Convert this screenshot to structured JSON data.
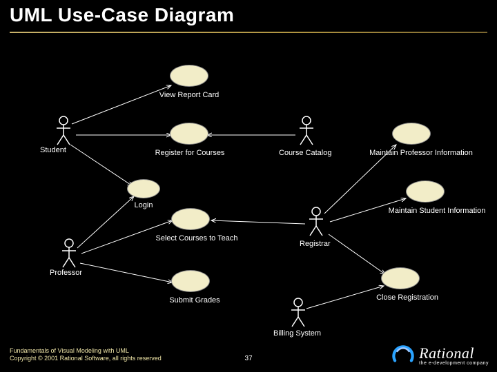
{
  "title": "UML Use-Case Diagram",
  "actors": {
    "student": "Student",
    "professor": "Professor",
    "courseCatalog": "Course Catalog",
    "registrar": "Registrar",
    "billingSystem": "Billing System"
  },
  "usecases": {
    "viewReportCard": "View Report Card",
    "registerForCourses": "Register for Courses",
    "login": "Login",
    "selectCoursesToTeach": "Select Courses to Teach",
    "submitGrades": "Submit Grades",
    "maintainProfessorInfo": "Maintain Professor Information",
    "maintainStudentInfo": "Maintain Student Information",
    "closeRegistration": "Close Registration"
  },
  "footer": {
    "line1": "Fundamentals of Visual Modeling with UML",
    "line2": "Copyright © 2001 Rational Software, all rights reserved"
  },
  "pageNumber": "37",
  "logo": {
    "name": "Rational",
    "tagline": "the e-development company"
  },
  "chart_data": {
    "type": "uml-use-case",
    "actors": [
      "Student",
      "Professor",
      "Course Catalog",
      "Registrar",
      "Billing System"
    ],
    "use_cases": [
      "View Report Card",
      "Register for Courses",
      "Login",
      "Select Courses to Teach",
      "Submit Grades",
      "Maintain Professor Information",
      "Maintain Student Information",
      "Close Registration"
    ],
    "associations": [
      [
        "Student",
        "View Report Card"
      ],
      [
        "Student",
        "Register for Courses"
      ],
      [
        "Student",
        "Login"
      ],
      [
        "Course Catalog",
        "Register for Courses"
      ],
      [
        "Professor",
        "Login"
      ],
      [
        "Professor",
        "Select Courses to Teach"
      ],
      [
        "Professor",
        "Submit Grades"
      ],
      [
        "Registrar",
        "Select Courses to Teach"
      ],
      [
        "Registrar",
        "Maintain Professor Information"
      ],
      [
        "Registrar",
        "Maintain Student Information"
      ],
      [
        "Registrar",
        "Close Registration"
      ],
      [
        "Billing System",
        "Close Registration"
      ]
    ]
  }
}
